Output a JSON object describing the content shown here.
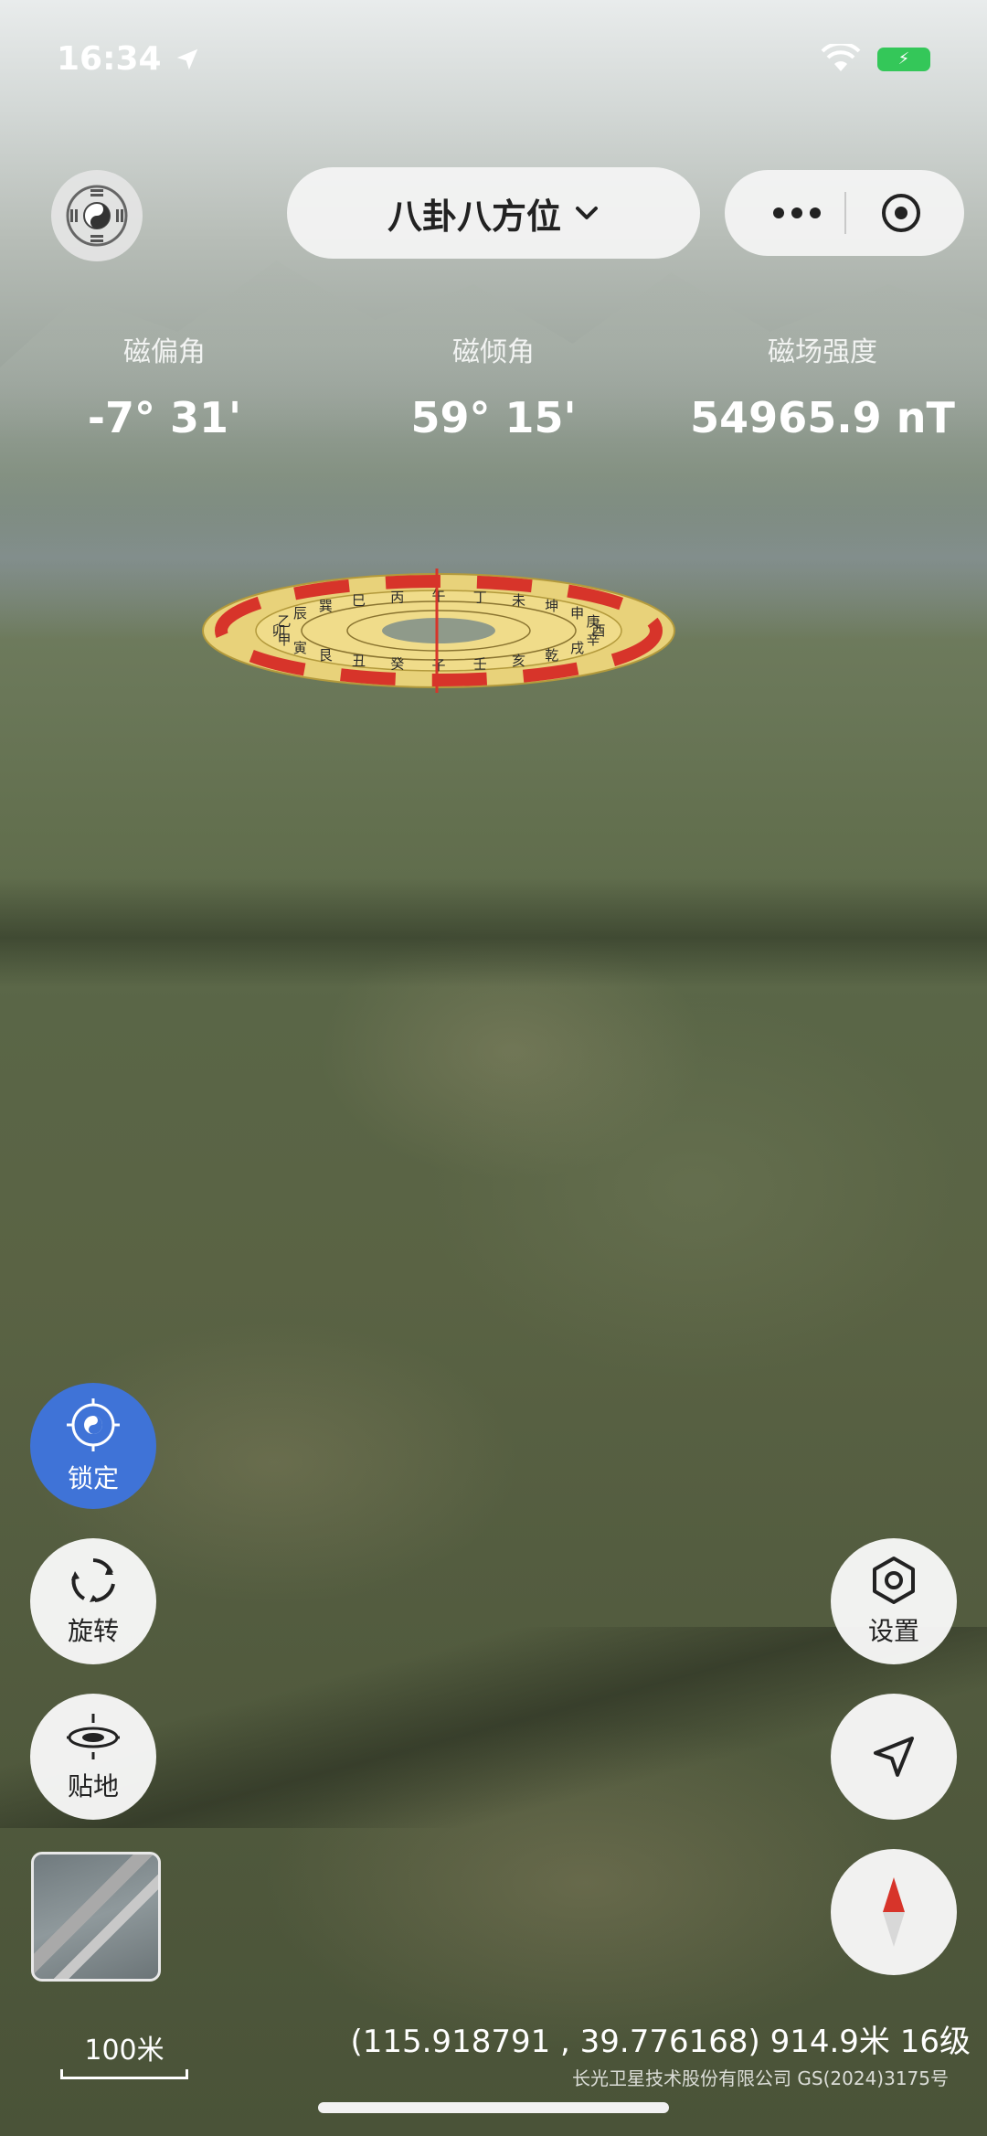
{
  "status_bar": {
    "time": "16:34"
  },
  "header": {
    "mode_label": "八卦八方位",
    "more_icon": "more-dots-icon",
    "target_icon": "target-icon"
  },
  "readings": [
    {
      "label": "磁偏角",
      "value": "-7° 31'"
    },
    {
      "label": "磁倾角",
      "value": "59° 15'"
    },
    {
      "label": "磁场强度",
      "value": "54965.9 nT"
    }
  ],
  "compass_plate": {
    "ring_chars": [
      "午",
      "丁",
      "未",
      "坤",
      "申",
      "庚",
      "酉",
      "辛",
      "戌",
      "乾",
      "亥",
      "壬",
      "子",
      "癸",
      "丑",
      "艮",
      "寅",
      "甲",
      "卯",
      "乙",
      "辰",
      "巽",
      "巳",
      "丙"
    ]
  },
  "left_controls": {
    "lock_label": "锁定",
    "rotate_label": "旋转",
    "ground_label": "贴地"
  },
  "right_controls": {
    "settings_label": "设置"
  },
  "map_info": {
    "scale_label": "100米",
    "coordinates": "(115.918791 , 39.776168) 914.9米 16级",
    "copyright": "长光卫星技术股份有限公司 GS(2024)3175号"
  },
  "colors": {
    "accent_blue": "#3f73d7",
    "battery_green": "#34c759",
    "compass_red": "#d7342a",
    "compass_gold": "#e8d27a"
  }
}
